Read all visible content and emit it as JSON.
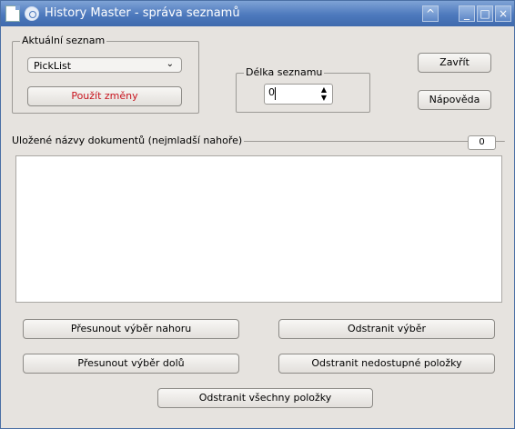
{
  "window": {
    "title": "History Master  - správa seznamů",
    "controls": {
      "shade": "^",
      "minimize": "_",
      "maximize": "□",
      "close": "×"
    }
  },
  "current_list": {
    "legend": "Aktuální seznam",
    "selected": "PickList",
    "apply_label": "Použít změny"
  },
  "list_length": {
    "legend": "Délka seznamu",
    "value": "0"
  },
  "buttons": {
    "close": "Zavřít",
    "help": "Nápověda"
  },
  "documents": {
    "legend": "Uložené názvy dokumentů (nejmladší nahoře)",
    "count": "0",
    "items": []
  },
  "actions": {
    "move_up": "Přesunout výběr nahoru",
    "move_down": "Přesunout výběr dolů",
    "remove_selected": "Odstranit výběr",
    "remove_unavailable": "Odstranit nedostupné položky",
    "remove_all": "Odstranit všechny položky"
  },
  "colors": {
    "title_bar": "#4d79bd",
    "apply_text": "#c8141e",
    "background": "#e6e3df"
  }
}
